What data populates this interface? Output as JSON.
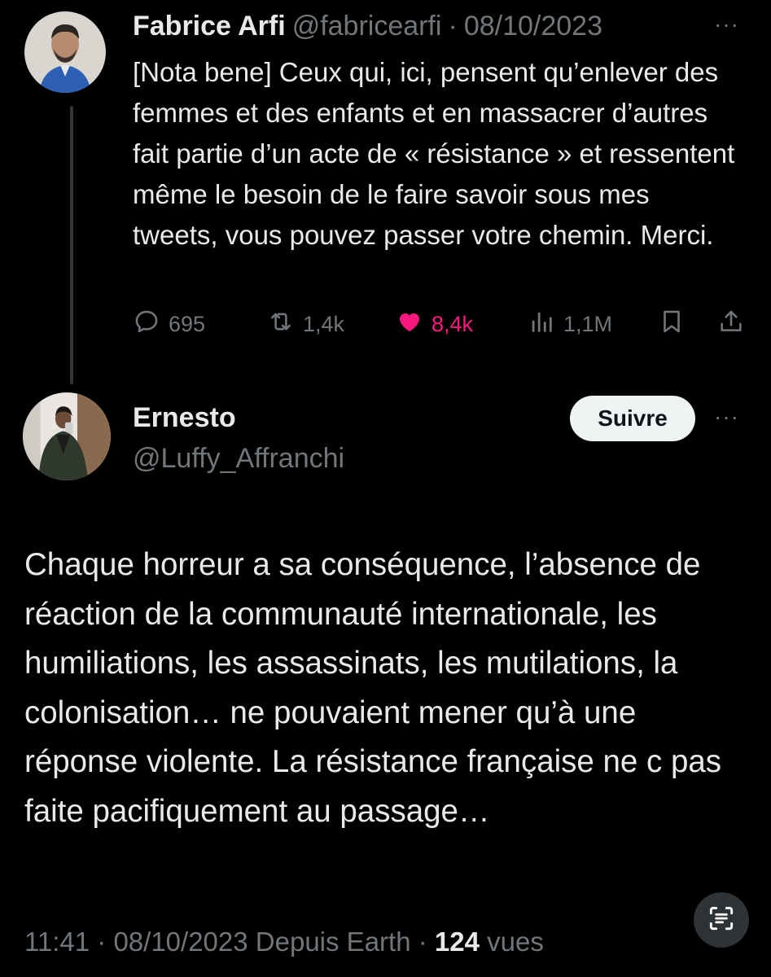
{
  "parent_tweet": {
    "author_name": "Fabrice Arfi",
    "author_handle": "@fabricearfi",
    "separator": "·",
    "date": "08/10/2023",
    "more": "···",
    "text": "[Nota bene] Ceux qui, ici, pensent qu’enlever des femmes et des enfants et en massacrer d’autres fait partie d’un acte de « résistance » et ressentent même le besoin de le faire savoir sous mes tweets, vous pouvez passer votre chemin. Merci.",
    "actions": {
      "replies": "695",
      "reposts": "1,4k",
      "likes": "8,4k",
      "views": "1,1M"
    }
  },
  "main_tweet": {
    "author_name": "Ernesto",
    "author_handle": "@Luffy_Affranchi",
    "follow_label": "Suivre",
    "more": "···",
    "text": "Chaque horreur a sa conséquence, l’absence de réaction de la communauté internationale, les humiliations, les assassinats, les mutilations, la colonisation… ne pouvaient mener qu’à une réponse violente. La résistance française ne c pas faite pacifiquement au passage…",
    "meta": {
      "time_date_source": "11:41 · 08/10/2023 Depuis Earth ·",
      "views_count": "124",
      "views_label": "vues"
    }
  },
  "colors": {
    "background": "#000000",
    "text": "#e7e9ea",
    "secondary": "#71767b",
    "like": "#f91880"
  },
  "icons": [
    "reply-icon",
    "repost-icon",
    "like-icon",
    "views-icon",
    "bookmark-icon",
    "share-icon",
    "scan-text-icon"
  ]
}
